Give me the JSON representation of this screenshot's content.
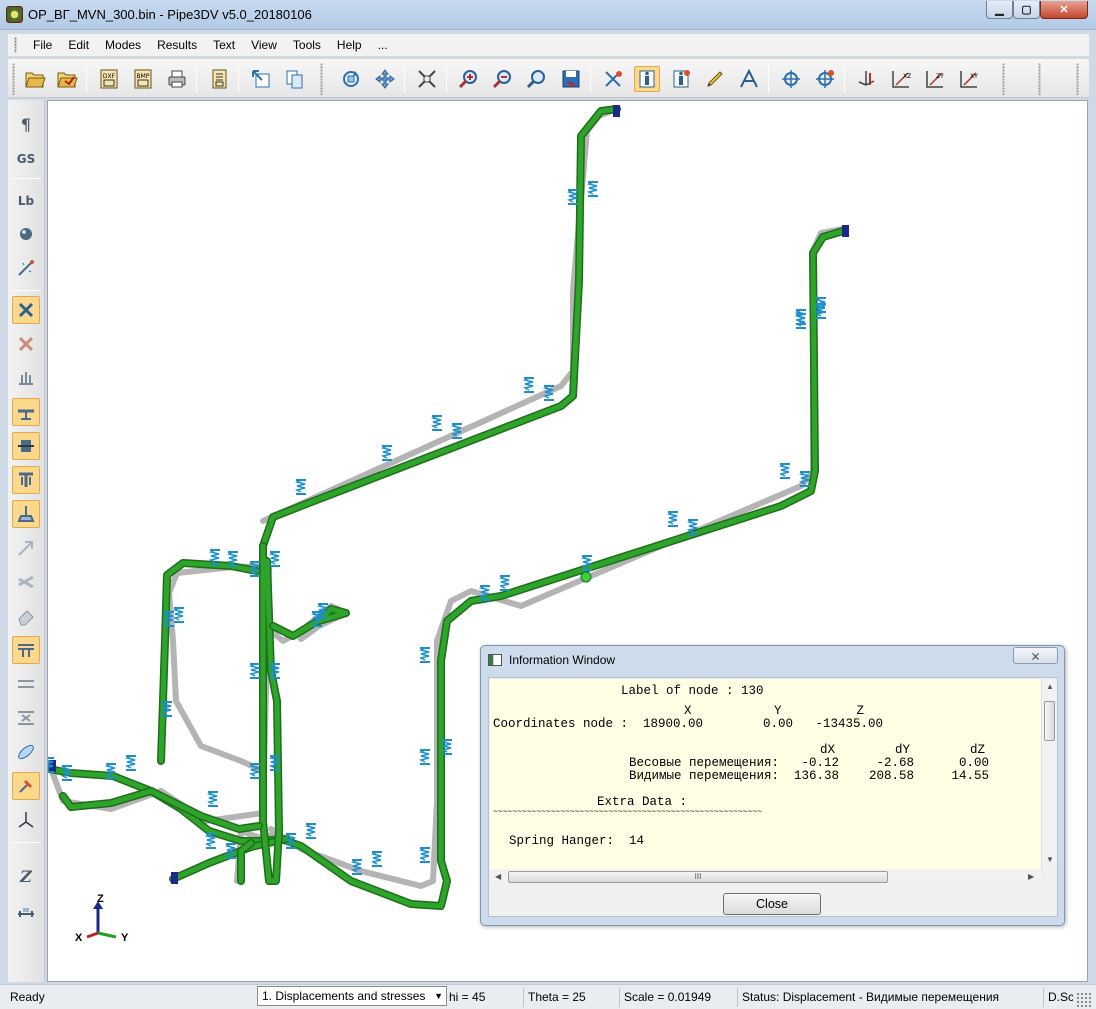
{
  "window": {
    "title": "OP_ВГ_MVN_300.bin - Pipe3DV v5.0_20180106",
    "minimize_glyph": "▁",
    "maximize_glyph": "▢",
    "close_glyph": "✕"
  },
  "menu": [
    "File",
    "Edit",
    "Modes",
    "Results",
    "Text",
    "View",
    "Tools",
    "Help",
    "..."
  ],
  "toolbar": {
    "buttons": [
      "open-icon",
      "open-recent-icon",
      "dxf-export-icon",
      "bmp-export-icon",
      "print-icon",
      "report-icon",
      "import-icon",
      "copy-icon",
      "rotate-icon",
      "pan-icon",
      "fit-icon",
      "zoom-in-icon",
      "zoom-out-icon",
      "zoom-window-icon",
      "zoom-save-icon",
      "axes-icon",
      "info-icon",
      "info-node-icon",
      "pen-icon",
      "angle-icon",
      "target-icon",
      "target-plus-icon",
      "view-iso-icon",
      "view-xz-icon",
      "view-zy-icon",
      "view-xy-icon"
    ],
    "active": [
      "info-icon"
    ],
    "dxf_label": "DXF",
    "bmp_label": "BMP",
    "view_labels": {
      "xz": "XZ",
      "zy": "ZY",
      "xy": "XY"
    }
  },
  "left_toolbar": {
    "buttons": [
      "paragraph-icon",
      "gs-icon",
      "lb-icon",
      "sphere-icon",
      "magic-icon",
      "cross-icon",
      "cross-disabled-icon",
      "anchor-icon",
      "support-a-icon",
      "support-b-icon",
      "support-c-icon",
      "support-d-icon",
      "arrow-icon",
      "crossed-icon",
      "eraser-icon",
      "beam-icon",
      "guide-a-icon",
      "guide-b-icon",
      "ellipse-icon",
      "hammer-icon",
      "axes3d-icon",
      "text-tool-icon",
      "ruler-icon"
    ],
    "active": [
      "cross-icon",
      "support-a-icon",
      "support-b-icon",
      "support-c-icon",
      "support-d-icon",
      "beam-icon",
      "hammer-icon"
    ],
    "labels": {
      "paragraph": "¶",
      "gs": "GS",
      "lb": "Lb",
      "text": "Z"
    }
  },
  "triad": {
    "z": "Z",
    "x": "X",
    "y": "Y"
  },
  "info_window": {
    "title": "Information Window",
    "close_x": "⨯",
    "lines": {
      "label": "Label of node : 130",
      "xyz_header": "X           Y          Z",
      "coords": "Coordinates node :  18900.00        0.00   -13435.00",
      "d_header": "dX        dY        dZ",
      "weight": "Весовые перемещения:   -0.12     -2.68      0.00",
      "visible": "Видимые перемещения:  136.38    208.58     14.55",
      "extra": "Extra Data :",
      "tilde": "~~~~~~~~~~~~~~~~~~~~~~~~~~~~~~~~~~~~~~~~~~~~~~~~~~~~~~~~",
      "spring": "Spring Hanger:  14"
    },
    "close_button": "Close",
    "hscroll_grip": "III"
  },
  "status_bar": {
    "ready": "Ready",
    "combo": "1.  Displacements and stresses",
    "phi": "hi = 45",
    "theta": "Theta = 25",
    "scale": "Scale = 0.01949",
    "status": "Status: Displacement - Видимые перемещения",
    "extra": "D.Sc"
  },
  "colors": {
    "pipe_deformed": "#2ea42a",
    "pipe_original": "#b4b4b4",
    "hanger": "#1c8fd0",
    "active_button": "#fcd88d"
  }
}
